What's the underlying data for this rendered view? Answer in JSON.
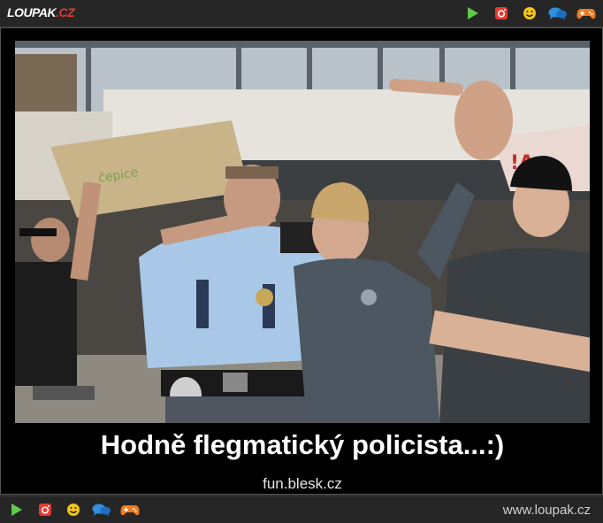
{
  "header": {
    "logo": {
      "left": "LOUPAK",
      "right": ".CZ"
    },
    "icons": [
      "play-icon",
      "instagram-icon",
      "smiley-icon",
      "chat-bubbles-icon",
      "gamepad-icon"
    ]
  },
  "post": {
    "caption": "Hodně flegmatický policista...:)",
    "source": "fun.blesk.cz"
  },
  "footer": {
    "icons": [
      "play-icon",
      "instagram-icon",
      "smiley-icon",
      "chat-bubbles-icon",
      "gamepad-icon"
    ],
    "site_url": "www.loupak.cz"
  },
  "colors": {
    "play": "#5fc94a",
    "instagram": "#e8392f",
    "smiley": "#f5c518",
    "chat": "#2f8fe0",
    "gamepad": "#f07a20"
  }
}
